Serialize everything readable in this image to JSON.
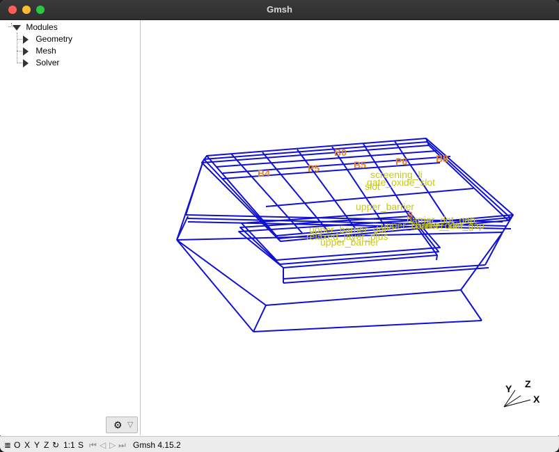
{
  "window": {
    "title": "Gmsh"
  },
  "tree": {
    "root": "Modules",
    "items": [
      "Geometry",
      "Mesh",
      "Solver"
    ]
  },
  "sidebar": {
    "gear_icon": "gear-icon",
    "dropdown_icon": "triangle-down-icon"
  },
  "viewport": {
    "colors": {
      "wire": "#1010d0",
      "physical_label": "#e8822a",
      "name_label": "#c8c81a"
    },
    "orange_labels": [
      "B4",
      "P5",
      "B0",
      "B5",
      "P6",
      "B8"
    ],
    "yellow_labels": [
      "screening_li",
      "gate_oxide_slot",
      "slot",
      "upper_barrier",
      "barrier_dot_gap",
      "upper_barrier_dot",
      "relaxed_layer_plus"
    ],
    "small_label": "S",
    "axes": {
      "x": "X",
      "y": "Y",
      "z": "Z"
    }
  },
  "statusbar": {
    "menu_icon": "≣",
    "buttons": [
      "O",
      "X",
      "Y",
      "Z"
    ],
    "rotate_icon": "↻",
    "ratio": "1:1",
    "s": "S",
    "nav": [
      "⏮",
      "◁",
      "▷",
      "⏭"
    ],
    "version": "Gmsh 4.15.2"
  }
}
